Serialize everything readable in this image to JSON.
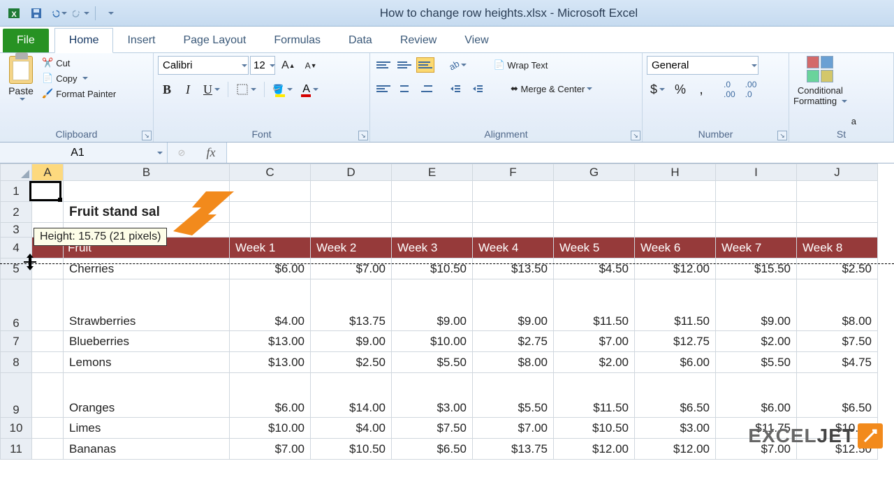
{
  "window": {
    "title": "How to change row heights.xlsx - Microsoft Excel"
  },
  "tabs": {
    "file": "File",
    "items": [
      "Home",
      "Insert",
      "Page Layout",
      "Formulas",
      "Data",
      "Review",
      "View"
    ],
    "active": 0
  },
  "ribbon": {
    "clipboard": {
      "label": "Clipboard",
      "paste": "Paste",
      "cut": "Cut",
      "copy": "Copy",
      "format_painter": "Format Painter"
    },
    "font": {
      "label": "Font",
      "name": "Calibri",
      "size": "12"
    },
    "alignment": {
      "label": "Alignment",
      "wrap": "Wrap Text",
      "merge": "Merge & Center"
    },
    "number": {
      "label": "Number",
      "format": "General"
    },
    "styles": {
      "label": "St",
      "cond": "Conditional",
      "cond2": "Formatting",
      "a": "a"
    }
  },
  "namebox": "A1",
  "formula": "",
  "columns": [
    "A",
    "B",
    "C",
    "D",
    "E",
    "F",
    "G",
    "H",
    "I",
    "J"
  ],
  "rows": [
    "1",
    "2",
    "3",
    "4",
    "5",
    "6",
    "7",
    "8",
    "9",
    "10",
    "11"
  ],
  "sheet": {
    "title": "Fruit stand sal",
    "header": [
      "Fruit",
      "Week 1",
      "Week 2",
      "Week 3",
      "Week 4",
      "Week 5",
      "Week 6",
      "Week 7",
      "Week 8"
    ],
    "data": [
      [
        "Cherries",
        "$6.00",
        "$7.00",
        "$10.50",
        "$13.50",
        "$4.50",
        "$12.00",
        "$15.50",
        "$2.50"
      ],
      [
        "Strawberries",
        "$4.00",
        "$13.75",
        "$9.00",
        "$9.00",
        "$11.50",
        "$11.50",
        "$9.00",
        "$8.00"
      ],
      [
        "Blueberries",
        "$13.00",
        "$9.00",
        "$10.00",
        "$2.75",
        "$7.00",
        "$12.75",
        "$2.00",
        "$7.50"
      ],
      [
        "Lemons",
        "$13.00",
        "$2.50",
        "$5.50",
        "$8.00",
        "$2.00",
        "$6.00",
        "$5.50",
        "$4.75"
      ],
      [
        "Oranges",
        "$6.00",
        "$14.00",
        "$3.00",
        "$5.50",
        "$11.50",
        "$6.50",
        "$6.00",
        "$6.50"
      ],
      [
        "Limes",
        "$10.00",
        "$4.00",
        "$7.50",
        "$7.00",
        "$10.50",
        "$3.00",
        "$11.75",
        "$10.50"
      ],
      [
        "Bananas",
        "$7.00",
        "$10.50",
        "$6.50",
        "$13.75",
        "$12.00",
        "$12.00",
        "$7.00",
        "$12.50"
      ]
    ]
  },
  "tooltip": "Height: 15.75 (21 pixels)",
  "watermark": {
    "text": "EXCEL",
    "suffix": "JET"
  },
  "chart_data": {
    "type": "table",
    "title": "Fruit stand sales",
    "categories": [
      "Week 1",
      "Week 2",
      "Week 3",
      "Week 4",
      "Week 5",
      "Week 6",
      "Week 7",
      "Week 8"
    ],
    "series": [
      {
        "name": "Cherries",
        "values": [
          6.0,
          7.0,
          10.5,
          13.5,
          4.5,
          12.0,
          15.5,
          2.5
        ]
      },
      {
        "name": "Strawberries",
        "values": [
          4.0,
          13.75,
          9.0,
          9.0,
          11.5,
          11.5,
          9.0,
          8.0
        ]
      },
      {
        "name": "Blueberries",
        "values": [
          13.0,
          9.0,
          10.0,
          2.75,
          7.0,
          12.75,
          2.0,
          7.5
        ]
      },
      {
        "name": "Lemons",
        "values": [
          13.0,
          2.5,
          5.5,
          8.0,
          2.0,
          6.0,
          5.5,
          4.75
        ]
      },
      {
        "name": "Oranges",
        "values": [
          6.0,
          14.0,
          3.0,
          5.5,
          11.5,
          6.5,
          6.0,
          6.5
        ]
      },
      {
        "name": "Limes",
        "values": [
          10.0,
          4.0,
          7.5,
          7.0,
          10.5,
          3.0,
          11.75,
          10.5
        ]
      },
      {
        "name": "Bananas",
        "values": [
          7.0,
          10.5,
          6.5,
          13.75,
          12.0,
          12.0,
          7.0,
          12.5
        ]
      }
    ]
  }
}
